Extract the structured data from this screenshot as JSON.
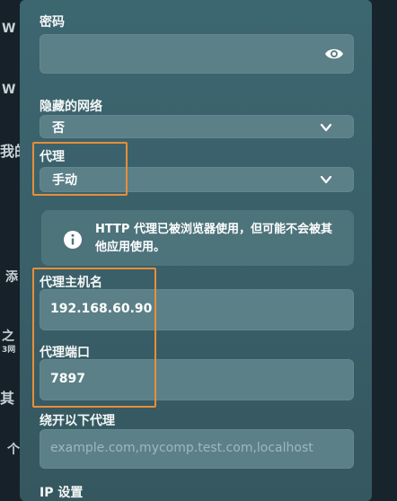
{
  "background": {
    "left_fragments": [
      "W",
      "W",
      "我的",
      "添",
      "之",
      "3网",
      "其",
      "个"
    ]
  },
  "form": {
    "password": {
      "label": "密码",
      "value": ""
    },
    "hidden_network": {
      "label": "隐藏的网络",
      "selected": "否"
    },
    "proxy": {
      "label": "代理",
      "selected": "手动"
    },
    "info": {
      "text": "HTTP 代理已被浏览器使用，但可能不会被其他应用使用。"
    },
    "proxy_host": {
      "label": "代理主机名",
      "value": "192.168.60.90"
    },
    "proxy_port": {
      "label": "代理端口",
      "value": "7897"
    },
    "bypass": {
      "label": "绕开以下代理",
      "placeholder": "example.com,mycomp.test.com,localhost"
    },
    "ip_settings": {
      "label": "IP 设置"
    }
  },
  "colors": {
    "highlight": "#e78e39",
    "panel": "#3c6670",
    "field": "#5b8088"
  },
  "icons": [
    "eye-icon",
    "chevron-down-icon",
    "info-icon"
  ]
}
